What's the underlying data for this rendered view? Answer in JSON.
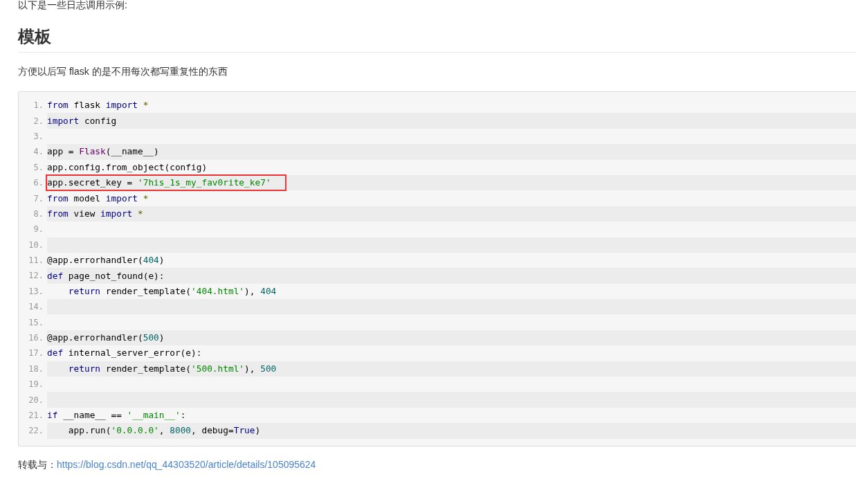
{
  "intro": "以下是一些日志调用示例:",
  "heading": "模板",
  "description": "方便以后写 flask 的是不用每次都写重复性的东西",
  "code_lines": [
    {
      "number": "1.",
      "highlighted": false,
      "tokens": [
        {
          "kind": "keyword",
          "text": "from"
        },
        {
          "kind": "plain",
          "text": " flask "
        },
        {
          "kind": "keyword",
          "text": "import"
        },
        {
          "kind": "operator",
          "text": " *"
        }
      ]
    },
    {
      "number": "2.",
      "highlighted": false,
      "tokens": [
        {
          "kind": "keyword",
          "text": "import"
        },
        {
          "kind": "plain",
          "text": " config"
        }
      ]
    },
    {
      "number": "3.",
      "highlighted": false
    },
    {
      "number": "4.",
      "highlighted": false,
      "tokens": [
        {
          "kind": "plain",
          "text": "app = "
        },
        {
          "kind": "type",
          "text": "Flask"
        },
        {
          "kind": "plain",
          "text": "(__name__)"
        }
      ]
    },
    {
      "number": "5.",
      "highlighted": false,
      "tokens": [
        {
          "kind": "plain",
          "text": "app.config.from_object(config)"
        }
      ]
    },
    {
      "number": "6.",
      "highlighted": true,
      "tokens": [
        {
          "kind": "plain",
          "text": "app.secret_key = "
        },
        {
          "kind": "string",
          "text": "'7his_1s_my_fav0rite_ke7'"
        }
      ]
    },
    {
      "number": "7.",
      "highlighted": false,
      "tokens": [
        {
          "kind": "keyword",
          "text": "from"
        },
        {
          "kind": "plain",
          "text": " model "
        },
        {
          "kind": "keyword",
          "text": "import"
        },
        {
          "kind": "operator",
          "text": " *"
        }
      ]
    },
    {
      "number": "8.",
      "highlighted": false,
      "tokens": [
        {
          "kind": "keyword",
          "text": "from"
        },
        {
          "kind": "plain",
          "text": " view "
        },
        {
          "kind": "keyword",
          "text": "import"
        },
        {
          "kind": "operator",
          "text": " *"
        }
      ]
    },
    {
      "number": "9.",
      "highlighted": false
    },
    {
      "number": "10.",
      "highlighted": false
    },
    {
      "number": "11.",
      "highlighted": false,
      "tokens": [
        {
          "kind": "plain",
          "text": "@app.errorhandler("
        },
        {
          "kind": "number",
          "text": "404"
        },
        {
          "kind": "plain",
          "text": ")"
        }
      ]
    },
    {
      "number": "12.",
      "highlighted": false,
      "tokens": [
        {
          "kind": "keyword",
          "text": "def"
        },
        {
          "kind": "plain",
          "text": " page_not_found(e):"
        }
      ]
    },
    {
      "number": "13.",
      "highlighted": false,
      "tokens": [
        {
          "kind": "keyword",
          "text": "    return"
        },
        {
          "kind": "plain",
          "text": " render_template("
        },
        {
          "kind": "string",
          "text": "'404.html'"
        },
        {
          "kind": "plain",
          "text": "), "
        },
        {
          "kind": "number",
          "text": "404"
        }
      ]
    },
    {
      "number": "14.",
      "highlighted": false
    },
    {
      "number": "15.",
      "highlighted": false
    },
    {
      "number": "16.",
      "highlighted": false,
      "tokens": [
        {
          "kind": "plain",
          "text": "@app.errorhandler("
        },
        {
          "kind": "number",
          "text": "500"
        },
        {
          "kind": "plain",
          "text": ")"
        }
      ]
    },
    {
      "number": "17.",
      "highlighted": false,
      "tokens": [
        {
          "kind": "keyword",
          "text": "def"
        },
        {
          "kind": "plain",
          "text": " internal_server_error(e):"
        }
      ]
    },
    {
      "number": "18.",
      "highlighted": false,
      "tokens": [
        {
          "kind": "keyword",
          "text": "    return"
        },
        {
          "kind": "plain",
          "text": " render_template("
        },
        {
          "kind": "string",
          "text": "'500.html'"
        },
        {
          "kind": "plain",
          "text": "), "
        },
        {
          "kind": "number",
          "text": "500"
        }
      ]
    },
    {
      "number": "19.",
      "highlighted": false
    },
    {
      "number": "20.",
      "highlighted": false
    },
    {
      "number": "21.",
      "highlighted": false,
      "tokens": [
        {
          "kind": "keyword",
          "text": "if"
        },
        {
          "kind": "plain",
          "text": " __name__ == "
        },
        {
          "kind": "string",
          "text": "'__main__'"
        },
        {
          "kind": "plain",
          "text": ":"
        }
      ]
    },
    {
      "number": "22.",
      "highlighted": false,
      "tokens": [
        {
          "kind": "plain",
          "text": "    app.run("
        },
        {
          "kind": "string",
          "text": "'0.0.0.0'"
        },
        {
          "kind": "plain",
          "text": ", "
        },
        {
          "kind": "number",
          "text": "8000"
        },
        {
          "kind": "plain",
          "text": ", debug="
        },
        {
          "kind": "keyword",
          "text": "True"
        },
        {
          "kind": "plain",
          "text": ")"
        }
      ]
    }
  ],
  "source": {
    "label": "转载与：",
    "url": "https://blog.csdn.net/qq_44303520/article/details/105095624"
  }
}
